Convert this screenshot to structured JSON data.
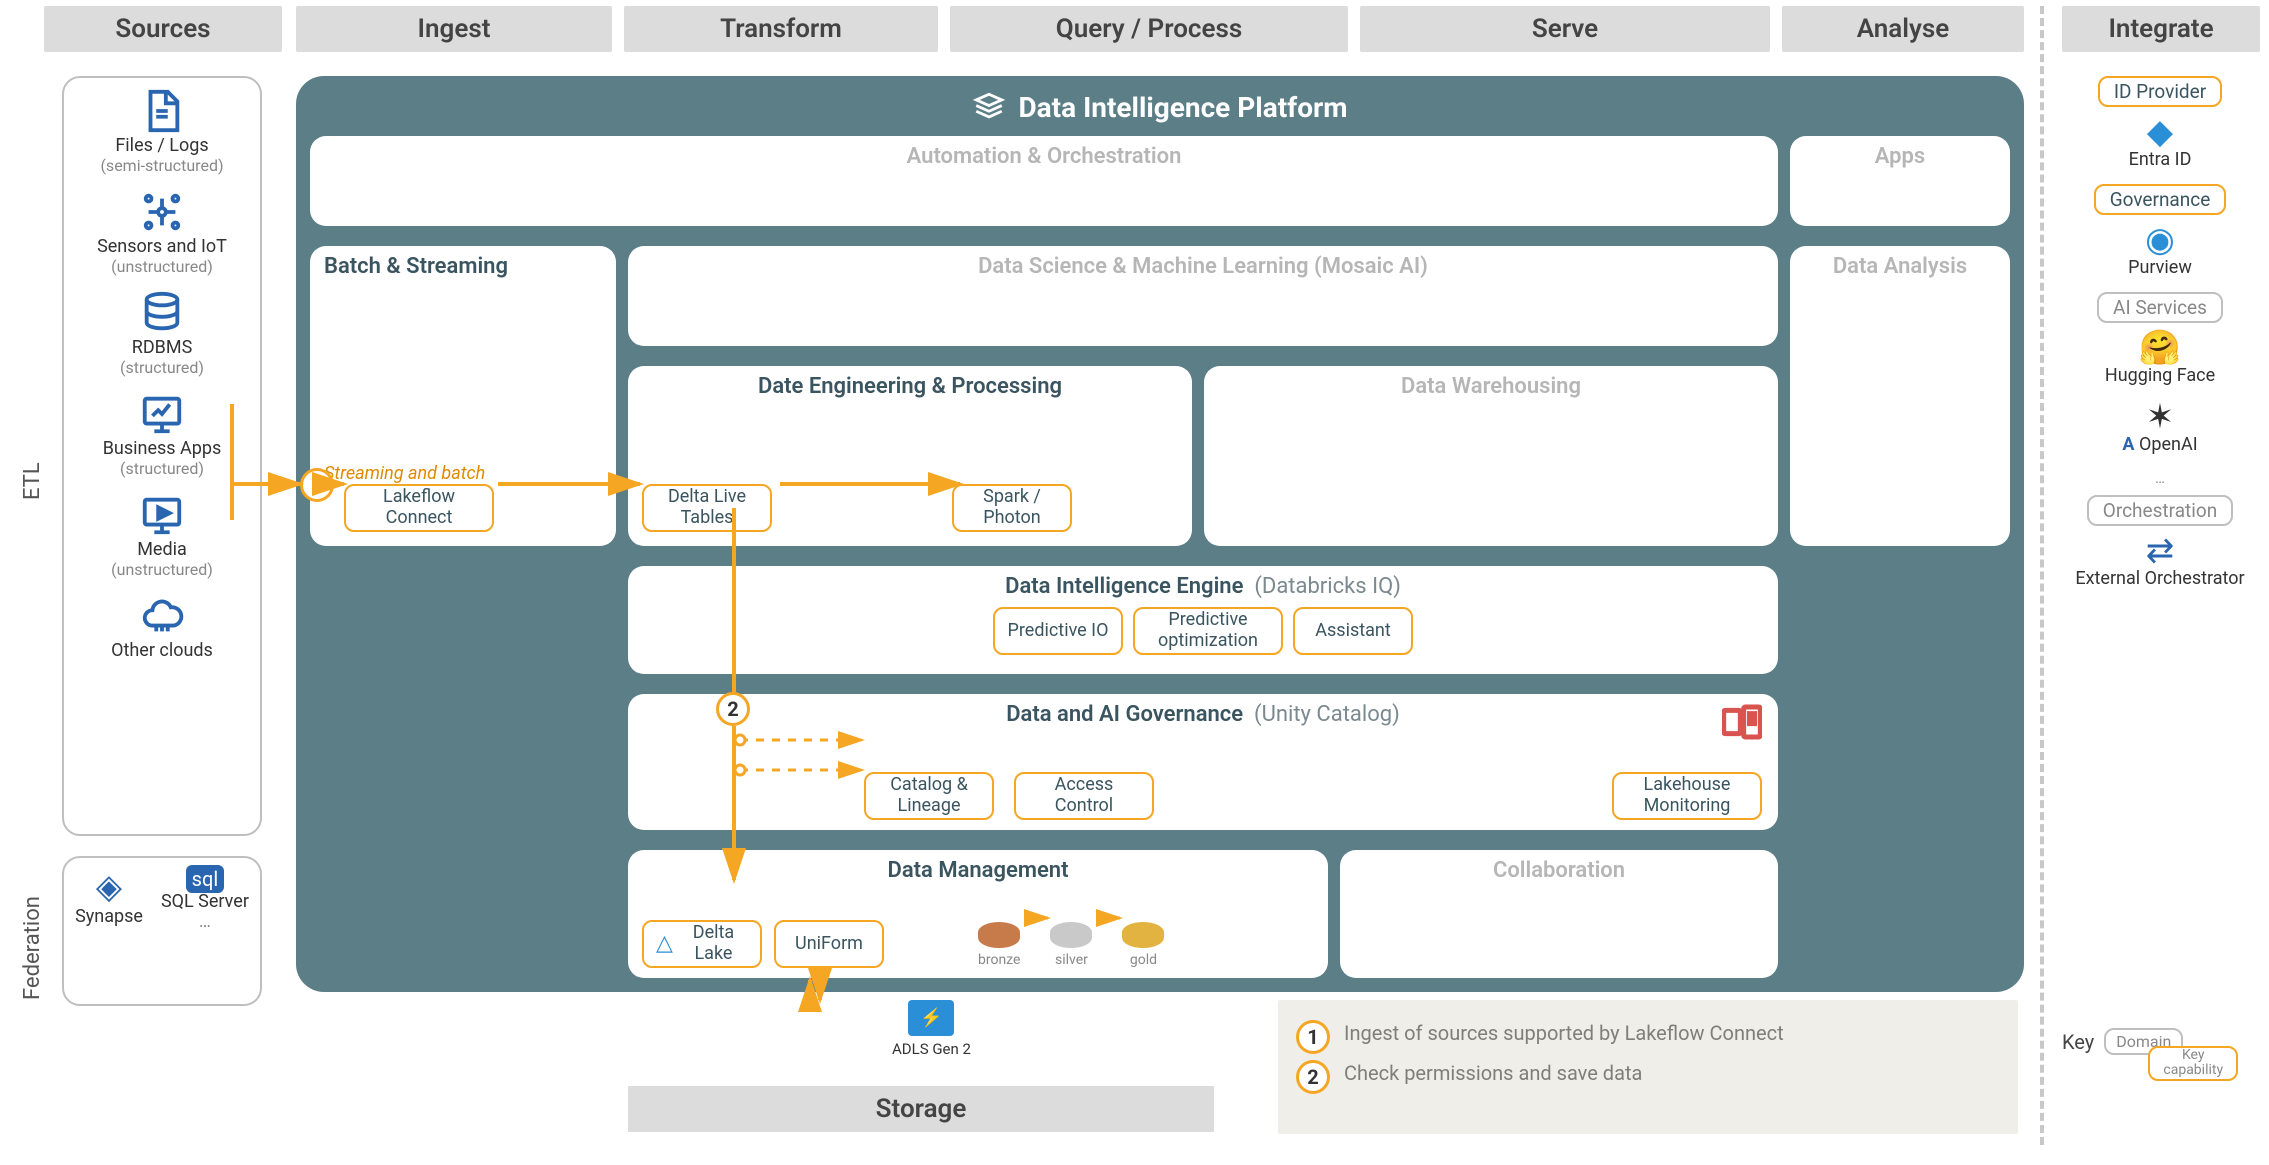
{
  "columns": {
    "sources": "Sources",
    "ingest": "Ingest",
    "transform": "Transform",
    "query": "Query / Process",
    "serve": "Serve",
    "analyse": "Analyse",
    "integrate": "Integrate"
  },
  "vlabels": {
    "etl": "ETL",
    "federation": "Federation"
  },
  "sources": [
    {
      "name": "Files / Logs",
      "sub": "(semi-structured)"
    },
    {
      "name": "Sensors and IoT",
      "sub": "(unstructured)"
    },
    {
      "name": "RDBMS",
      "sub": "(structured)"
    },
    {
      "name": "Business Apps",
      "sub": "(structured)"
    },
    {
      "name": "Media",
      "sub": "(unstructured)"
    },
    {
      "name": "Other clouds",
      "sub": ""
    }
  ],
  "federation": [
    {
      "name": "Synapse"
    },
    {
      "name": "SQL Server"
    }
  ],
  "federation_ellipsis": "…",
  "platform_title": "Data Intelligence Platform",
  "cards": {
    "automation": "Automation & Orchestration",
    "apps": "Apps",
    "batch_stream": "Batch & Streaming",
    "dsml": "Data Science & Machine Learning  (Mosaic AI)",
    "data_analysis": "Data Analysis",
    "de_proc": "Date Engineering & Processing",
    "dw": "Data Warehousing",
    "di_engine": "Data Intelligence Engine",
    "di_engine_suffix": "(Databricks IQ)",
    "gov": "Data and AI Governance",
    "gov_suffix": "(Unity Catalog)",
    "data_mgmt": "Data Management",
    "collab": "Collaboration"
  },
  "capabilities": {
    "lakeflow": "Lakeflow Connect",
    "stream_annot": "Streaming and batch",
    "dlt": "Delta Live Tables",
    "spark": "Spark / Photon",
    "pred_io": "Predictive IO",
    "pred_opt": "Predictive optimization",
    "assistant": "Assistant",
    "catalog_lineage": "Catalog & Lineage",
    "access_ctl": "Access Control",
    "lh_monitor": "Lakehouse Monitoring",
    "delta_lake": "Delta Lake",
    "uniform": "UniForm"
  },
  "medallion": {
    "b": "bronze",
    "s": "silver",
    "g": "gold"
  },
  "storage": {
    "adls": "ADLS Gen 2",
    "label": "Storage"
  },
  "integrate": {
    "id_provider": "ID Provider",
    "entra": "Entra ID",
    "governance": "Governance",
    "purview": "Purview",
    "ai_services": "AI Services",
    "hf": "Hugging Face",
    "openai": "OpenAI",
    "orchestration": "Orchestration",
    "ext_orch": "External Orchestrator",
    "ellipsis": "…"
  },
  "legend": {
    "l1": "Ingest of sources supported by Lakeflow Connect",
    "l2": "Check permissions and save data"
  },
  "key": {
    "label": "Key",
    "domain": "Domain",
    "cap": "Key capability"
  }
}
